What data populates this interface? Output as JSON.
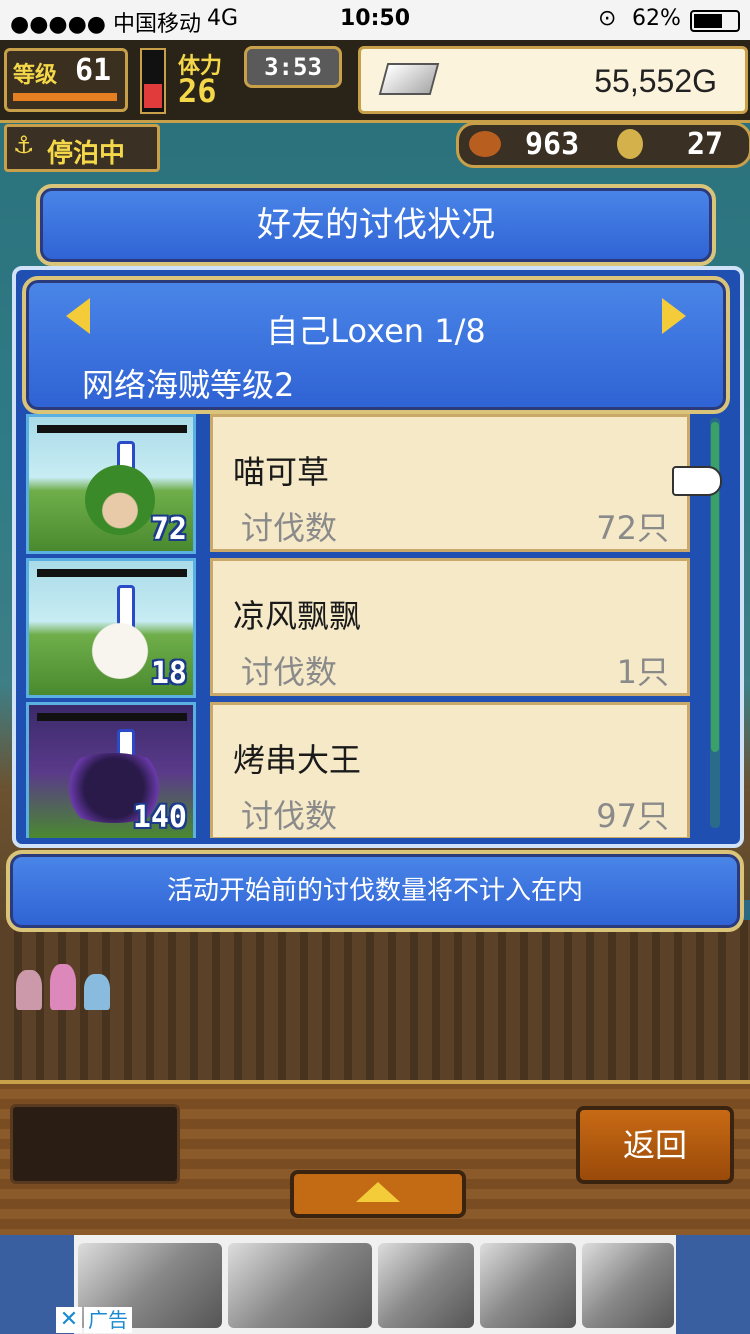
{
  "status_bar": {
    "carrier": "●●●●● 中国移动",
    "network": "4G",
    "time": "10:50",
    "battery": "62%"
  },
  "hud": {
    "level_label": "等级",
    "level": "61",
    "stamina_label": "体力",
    "stamina": "26",
    "timer": "3:53",
    "gold": "55,552G",
    "dock_status": "停泊中",
    "food": "963",
    "medals": "27"
  },
  "dialog": {
    "title": "好友的讨伐状况",
    "friend": "自己Loxen 1/8",
    "pirate_level": "网络海贼等级2",
    "rows": [
      {
        "name": "喵可草",
        "kill_label": "讨伐数",
        "count": "72只",
        "level": "72"
      },
      {
        "name": "凉风飘飘",
        "kill_label": "讨伐数",
        "count": "1只",
        "level": "18"
      },
      {
        "name": "烤串大王",
        "kill_label": "讨伐数",
        "count": "97只",
        "level": "140"
      }
    ],
    "notice": "活动开始前的讨伐数量将不计入在内"
  },
  "bottom": {
    "back_label": "返回"
  },
  "ad": {
    "label": "广告",
    "close": "✕"
  },
  "colors": {
    "panel_blue": "#3a72e0",
    "gold_border": "#d9c47a",
    "parchment": "#f6e9c8"
  }
}
